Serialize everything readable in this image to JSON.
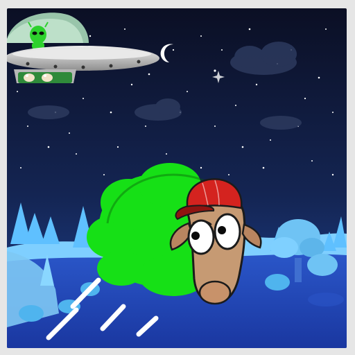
{
  "game": {
    "type": "arcade",
    "icons": {
      "ufo": "ufo-icon",
      "alien": "alien-icon",
      "sheep": "sheep-character",
      "moon": "crescent-moon-icon",
      "tree": "tree-icon"
    },
    "colors": {
      "sky_top": "#0b0f24",
      "sky_bottom": "#1c3a86",
      "ground": "#1d43b8",
      "snow": "#7fd0ff",
      "wool": "#14e214",
      "cap": "#d4231f",
      "alien": "#2dd12d",
      "ufo_metal": "#c9c9c9",
      "ufo_dome": "#bfe3c9",
      "speed_lines": "#ffffff"
    },
    "ufo_cargo_sheep_count": 2
  }
}
